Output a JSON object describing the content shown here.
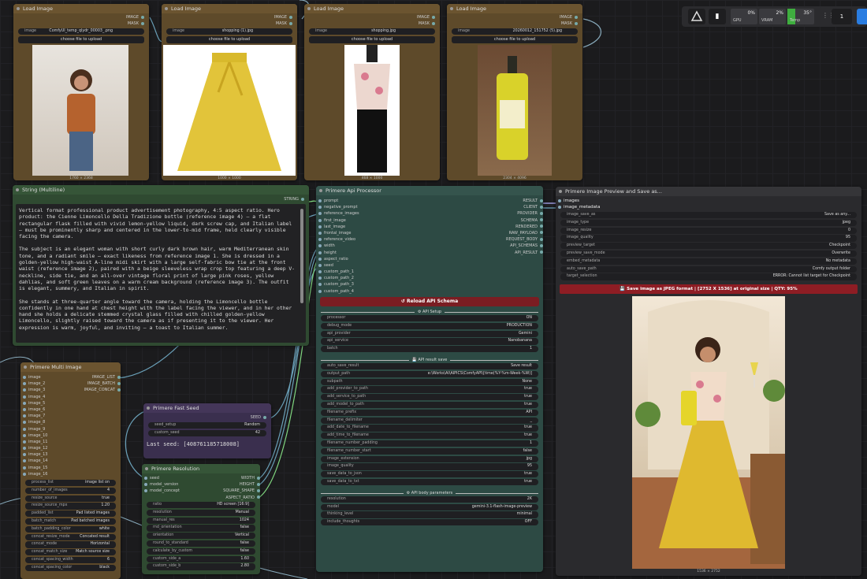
{
  "topbar": {
    "gpu_label": "GPU",
    "gpu_value": "0%",
    "vram_label": "VRAM",
    "vram_value": "2%",
    "temp_label": "Temp",
    "temp_value": "35°",
    "counter": "1"
  },
  "load_image_nodes": [
    {
      "title": "Load Image",
      "out1": "IMAGE",
      "out2": "MASK",
      "image_label": "image",
      "file": "ComfyUI_temp_qlydr_00003_.png",
      "upload": "choose file to upload",
      "size": "1760 × 2368"
    },
    {
      "title": "Load Image",
      "out1": "IMAGE",
      "out2": "MASK",
      "image_label": "image",
      "file": "shopping (1).jpg",
      "upload": "choose file to upload",
      "size": "1000 × 1000"
    },
    {
      "title": "Load Image",
      "out1": "IMAGE",
      "out2": "MASK",
      "image_label": "image",
      "file": "shopping.jpg",
      "upload": "choose file to upload",
      "size": "468 × 1000"
    },
    {
      "title": "Load Image",
      "out1": "IMAGE",
      "out2": "MASK",
      "image_label": "image",
      "file": "20260012_151752 (5).jpg",
      "upload": "choose file to upload",
      "size": "2304 × 4096"
    }
  ],
  "string_node": {
    "title": "String (Multiline)",
    "out": "STRING",
    "p1": "Vertical format professional product advertisement photography, 4:5 aspect ratio. Hero product: the Cienne Limoncello Della Tradizione bottle (reference image 4) – a flat rectangular flask filled with vivid lemon-yellow liquid, dark screw cap, and Italian label – must be prominently sharp and centered in the lower-to-mid frame, held clearly visible facing the camera.",
    "p2": "The subject is an elegant woman with short curly dark brown hair, warm Mediterranean skin tone, and a radiant smile – exact likeness from reference image 1. She is dressed in a golden-yellow high-waist A-line midi skirt with a large self-fabric bow tie at the front waist (reference image 2), paired with a beige sleeveless wrap crop top featuring a deep V-neckline, side tie, and an all-over vintage floral print of large pink roses, yellow dahlias, and soft green leaves on a warm cream background (reference image 3). The outfit is elegant, summery, and Italian in spirit.",
    "p3": "She stands at three-quarter angle toward the camera, holding the Limoncello bottle confidently in one hand at chest height with the label facing the viewer, and in her other hand she holds a delicate stemmed crystal glass filled with chilled golden-yellow Limoncello, slightly raised toward the camera as if presenting it to the viewer. Her expression is warm, joyful, and inviting – a toast to Italian summer."
  },
  "multi_image": {
    "title": "Primere Multi Image",
    "inputs": [
      "image",
      "image_2",
      "image_3",
      "image_4",
      "image_5",
      "image_6",
      "image_7",
      "image_8",
      "image_9",
      "image_10",
      "image_11",
      "image_12",
      "image_13",
      "image_14",
      "image_15",
      "image_16"
    ],
    "outputs": [
      "IMAGE_LIST",
      "IMAGE_BATCH",
      "IMAGE_CONCAT"
    ],
    "widgets": [
      [
        "process_list",
        "image list on"
      ],
      [
        "number_of_images",
        "4"
      ],
      [
        "resize_source",
        "true"
      ],
      [
        "resize_source_mpx",
        "1.20"
      ],
      [
        "padded_list",
        "Pad listed images"
      ],
      [
        "batch_match",
        "Pad batched images"
      ],
      [
        "batch_padding_color",
        "white"
      ],
      [
        "concat_resize_mode",
        "Concated result"
      ],
      [
        "concat_mode",
        "Horizontal"
      ],
      [
        "concat_match_size",
        "Match source size"
      ],
      [
        "concat_spacing_width",
        "6"
      ],
      [
        "concat_spacing_color",
        "black"
      ]
    ]
  },
  "fast_seed": {
    "title": "Primere Fast Seed",
    "out": "SEED",
    "w1": [
      "seed_setup",
      "Random"
    ],
    "w2": [
      "custom_seed",
      "42"
    ],
    "last": "Last seed: [408761185718008]"
  },
  "resolution": {
    "title": "Primere Resolution",
    "inputs": [
      "seed",
      "model_version",
      "model_concept"
    ],
    "outputs": [
      "WIDTH",
      "HEIGHT",
      "SQUARE_SHAPE",
      "ASPECT_RATIO"
    ],
    "widgets": [
      [
        "ratio",
        "HD screen [16:9]"
      ],
      [
        "resolution",
        "Manual"
      ],
      [
        "manual_res",
        "1024"
      ],
      [
        "rnd_orientation",
        "false"
      ],
      [
        "orientation",
        "Vertical"
      ],
      [
        "round_to_standard",
        "false"
      ],
      [
        "calculate_by_custom",
        "false"
      ],
      [
        "custom_side_a",
        "1.60"
      ],
      [
        "custom_side_b",
        "2.80"
      ]
    ]
  },
  "api": {
    "title": "Primere Api Processor",
    "inputs": [
      "prompt",
      "negative_prompt",
      "reference_images",
      "first_image",
      "last_image",
      "frontal_image",
      "reference_video",
      "width",
      "height",
      "aspect_ratio",
      "seed",
      "custom_path_1",
      "custom_path_2",
      "custom_path_3",
      "custom_path_4"
    ],
    "outputs": [
      "RESULT",
      "CLIENT",
      "PROVIDER",
      "SCHEMA",
      "RENDERED",
      "RAW_PAYLOAD",
      "REQUEST_BODY",
      "API_SCHEMAS",
      "API_RESULT"
    ],
    "reload": "↺ Reload API Schema",
    "sec1": "⚙ API Setup",
    "setup": [
      [
        "processor",
        "ON"
      ],
      [
        "debug_mode",
        "PRODUCTION"
      ],
      [
        "api_provider",
        "Gemini"
      ],
      [
        "api_service",
        "Nanobanana"
      ],
      [
        "batch",
        "1"
      ]
    ],
    "sec2": "💾 API result save",
    "save": [
      [
        "auto_save_result",
        "Save result"
      ],
      [
        "output_path",
        "e:\\Works\\AI\\AIPICS\\ComfyAPI\\[time(%Y-%m-Week-%W)]"
      ],
      [
        "subpath",
        "None"
      ],
      [
        "add_provider_to_path",
        "true"
      ],
      [
        "add_service_to_path",
        "true"
      ],
      [
        "add_model_to_path",
        "true"
      ],
      [
        "filename_prefix",
        "API"
      ],
      [
        "filename_delimiter",
        "_"
      ],
      [
        "add_date_to_filename",
        "true"
      ],
      [
        "add_time_to_filename",
        "true"
      ],
      [
        "filename_number_padding",
        "1"
      ],
      [
        "filename_number_start",
        "false"
      ],
      [
        "image_extension",
        "jpg"
      ],
      [
        "image_quality",
        "95"
      ],
      [
        "save_data_to_json",
        "true"
      ],
      [
        "save_data_to_txt",
        "true"
      ]
    ],
    "sec3": "⚙ API body parameters",
    "body": [
      [
        "resolution",
        "2K"
      ],
      [
        "model",
        "gemini-3.1-flash-image-preview"
      ],
      [
        "thinking_level",
        "minimal"
      ],
      [
        "include_thoughts",
        "OFF"
      ]
    ]
  },
  "preview": {
    "title": "Primere Image Preview and Save as...",
    "inputs": [
      "images",
      "image_metadata"
    ],
    "widgets": [
      [
        "image_save_as",
        "Save as any..."
      ],
      [
        "image_type",
        "jpeg"
      ],
      [
        "image_resize",
        "0"
      ],
      [
        "image_quality",
        "95"
      ],
      [
        "preview_target",
        "Checkpoint"
      ],
      [
        "preview_save_mode",
        "Overwrite"
      ],
      [
        "embed_metadata",
        "No metadata"
      ],
      [
        "auto_save_path",
        "Comfy output folder"
      ],
      [
        "target_selection",
        "ERROR: Cannot list target for Checkpoint"
      ]
    ],
    "save_btn": "💾 Save image as JPEG format | [2752 X 1536] at original size | QTY: 95%",
    "size": "1536 × 2752"
  }
}
